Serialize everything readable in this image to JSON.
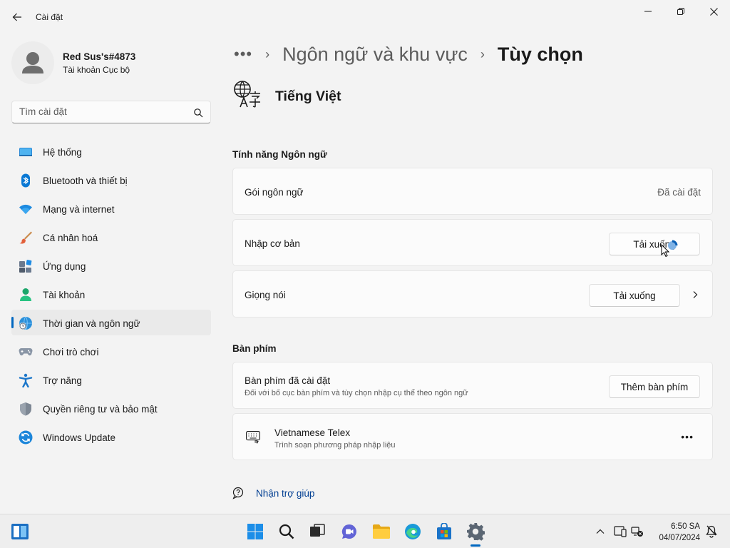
{
  "window": {
    "app_title": "Cài đặt"
  },
  "profile": {
    "name": "Red Sus's#4873",
    "account_type": "Tài khoản Cục bộ"
  },
  "search": {
    "placeholder": "Tìm cài đặt"
  },
  "sidebar": {
    "items": [
      {
        "label": "Hệ thống",
        "icon": "monitor-icon"
      },
      {
        "label": "Bluetooth và thiết bị",
        "icon": "bluetooth-icon"
      },
      {
        "label": "Mạng và internet",
        "icon": "wifi-icon"
      },
      {
        "label": "Cá nhân hoá",
        "icon": "brush-icon"
      },
      {
        "label": "Ứng dụng",
        "icon": "apps-icon"
      },
      {
        "label": "Tài khoản",
        "icon": "person-icon"
      },
      {
        "label": "Thời gian và ngôn ngữ",
        "icon": "globe-clock-icon",
        "active": true
      },
      {
        "label": "Chơi trò chơi",
        "icon": "gamepad-icon"
      },
      {
        "label": "Trợ năng",
        "icon": "accessibility-icon"
      },
      {
        "label": "Quyền riêng tư và bảo mật",
        "icon": "shield-icon"
      },
      {
        "label": "Windows Update",
        "icon": "update-icon"
      }
    ]
  },
  "breadcrumb": {
    "more": "•••",
    "separator": "›",
    "parent": "Ngôn ngữ và khu vực",
    "current": "Tùy chọn"
  },
  "language": {
    "title": "Tiếng Việt"
  },
  "features_section": {
    "title": "Tính năng Ngôn ngữ",
    "language_pack": {
      "label": "Gói ngôn ngữ",
      "status": "Đã cài đặt"
    },
    "basic_typing": {
      "label": "Nhập cơ bản",
      "button": "Tải xuống"
    },
    "speech": {
      "label": "Giọng nói",
      "button": "Tải xuống"
    }
  },
  "keyboard_section": {
    "title": "Bàn phím",
    "installed": {
      "label": "Bàn phím đã cài đặt",
      "description": "Đối với bố cục bàn phím và tùy chọn nhập cụ thể theo ngôn ngữ",
      "button": "Thêm bàn phím"
    },
    "keyboard_item": {
      "name": "Vietnamese Telex",
      "description": "Trình soạn phương pháp nhập liệu",
      "more": "•••"
    }
  },
  "help": {
    "label": "Nhận trợ giúp"
  },
  "taskbar": {
    "time": "6:50 SA",
    "date": "04/07/2024"
  },
  "colors": {
    "accent": "#0067c0",
    "link": "#003e92",
    "background": "#f3f3f3",
    "card": "#fbfbfb"
  }
}
